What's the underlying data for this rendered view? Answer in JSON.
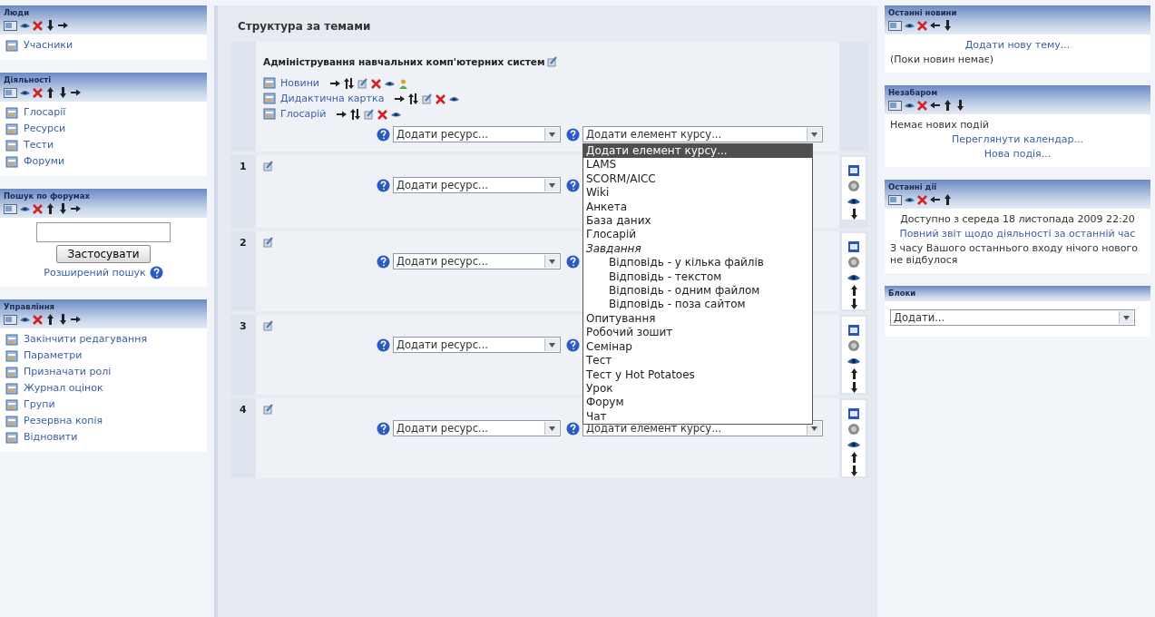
{
  "left_blocks": [
    {
      "title": "Люди",
      "controls": [
        {
          "kind": "edit"
        },
        {
          "kind": "hide"
        },
        {
          "kind": "delete"
        },
        {
          "kind": "down"
        },
        {
          "kind": "right"
        }
      ],
      "content": [
        {
          "kind": "item",
          "label": "Учасники"
        }
      ]
    },
    {
      "title": "Діяльності",
      "controls": [
        {
          "kind": "edit"
        },
        {
          "kind": "hide"
        },
        {
          "kind": "delete"
        },
        {
          "kind": "up"
        },
        {
          "kind": "down"
        },
        {
          "kind": "right"
        }
      ],
      "content": [
        {
          "kind": "item",
          "label": "Глосарії"
        },
        {
          "kind": "item",
          "label": "Ресурси"
        },
        {
          "kind": "item",
          "label": "Тести"
        },
        {
          "kind": "item",
          "label": "Форуми"
        }
      ]
    },
    {
      "title": "Пошук по форумах",
      "controls": [
        {
          "kind": "edit"
        },
        {
          "kind": "hide"
        },
        {
          "kind": "delete"
        },
        {
          "kind": "up"
        },
        {
          "kind": "down"
        },
        {
          "kind": "right"
        }
      ],
      "content": [
        {
          "kind": "search",
          "button": "Застосувати",
          "link": "Розширений пошук"
        }
      ]
    },
    {
      "title": "Управління",
      "controls": [
        {
          "kind": "edit"
        },
        {
          "kind": "hide"
        },
        {
          "kind": "delete"
        },
        {
          "kind": "up"
        },
        {
          "kind": "down"
        },
        {
          "kind": "right"
        }
      ],
      "content": [
        {
          "kind": "item",
          "label": "Закінчити редагування"
        },
        {
          "kind": "item",
          "label": "Параметри"
        },
        {
          "kind": "item",
          "label": "Призначати ролі"
        },
        {
          "kind": "item",
          "label": "Журнал оцінок"
        },
        {
          "kind": "item",
          "label": "Групи"
        },
        {
          "kind": "item",
          "label": "Резервна копія"
        },
        {
          "kind": "item",
          "label": "Відновити"
        }
      ]
    }
  ],
  "main": {
    "title": "Структура за темами",
    "sections": [
      {
        "title": "Адміністрування навчальних комп'ютерних систем",
        "activities": [
          {
            "label": "Новини",
            "controls": [
              {
                "kind": "right"
              },
              {
                "kind": "move"
              },
              {
                "kind": "editdoc"
              },
              {
                "kind": "delete"
              },
              {
                "kind": "hide"
              },
              {
                "kind": "group"
              }
            ]
          },
          {
            "label": "Дидактична картка",
            "controls": [
              {
                "kind": "right"
              },
              {
                "kind": "move"
              },
              {
                "kind": "editdoc"
              },
              {
                "kind": "delete"
              },
              {
                "kind": "hide"
              }
            ]
          },
          {
            "label": "Глосарій",
            "controls": [
              {
                "kind": "right"
              },
              {
                "kind": "move"
              },
              {
                "kind": "editdoc"
              },
              {
                "kind": "delete"
              },
              {
                "kind": "hide"
              }
            ]
          }
        ],
        "resource_select": "Додати ресурс...",
        "activity_select": "Додати елемент курсу...",
        "dropdown": [
          {
            "label": "Додати елемент курсу...",
            "selected": true
          },
          {
            "label": "LAMS",
            "selected": false
          },
          {
            "label": "SCORM/AICC",
            "selected": false
          },
          {
            "label": "Wiki",
            "selected": false
          },
          {
            "label": "Анкета",
            "selected": false
          },
          {
            "label": "База даних",
            "selected": false
          },
          {
            "label": "Глосарій",
            "selected": false
          },
          {
            "label": "Завдання",
            "selected": false,
            "children": [
              {
                "label": "Відповідь - у кілька файлів",
                "selected": false
              },
              {
                "label": "Відповідь - текстом",
                "selected": false
              },
              {
                "label": "Відповідь - одним файлом",
                "selected": false
              },
              {
                "label": "Відповідь - поза сайтом",
                "selected": false
              }
            ]
          },
          {
            "label": "Опитування",
            "selected": false
          },
          {
            "label": "Робочий зошит",
            "selected": false
          },
          {
            "label": "Семінар",
            "selected": false
          },
          {
            "label": "Тест",
            "selected": false
          },
          {
            "label": "Тест у Hot Potatoes",
            "selected": false
          },
          {
            "label": "Урок",
            "selected": false
          },
          {
            "label": "Форум",
            "selected": false
          },
          {
            "label": "Чат",
            "selected": false
          }
        ]
      },
      {
        "number": "1",
        "resource_select": "Додати ресурс...",
        "side_controls": [
          {
            "kind": "box"
          },
          {
            "kind": "circle"
          },
          {
            "kind": "hide"
          },
          {
            "kind": "down"
          }
        ]
      },
      {
        "number": "2",
        "resource_select": "Додати ресурс...",
        "side_controls": [
          {
            "kind": "box"
          },
          {
            "kind": "circle"
          },
          {
            "kind": "hide"
          },
          {
            "kind": "up"
          },
          {
            "kind": "down"
          }
        ]
      },
      {
        "number": "3",
        "resource_select": "Додати ресурс...",
        "side_controls": [
          {
            "kind": "box"
          },
          {
            "kind": "circle"
          },
          {
            "kind": "hide"
          },
          {
            "kind": "up"
          },
          {
            "kind": "down"
          }
        ]
      },
      {
        "number": "4",
        "resource_select": "Додати ресурс...",
        "activity_select": "Додати елемент курсу...",
        "side_controls": [
          {
            "kind": "box"
          },
          {
            "kind": "circle"
          },
          {
            "kind": "hide"
          },
          {
            "kind": "up"
          },
          {
            "kind": "down"
          }
        ]
      }
    ]
  },
  "right_blocks": [
    {
      "title": "Останні новини",
      "controls": [
        {
          "kind": "edit"
        },
        {
          "kind": "hide"
        },
        {
          "kind": "delete"
        },
        {
          "kind": "left"
        },
        {
          "kind": "down"
        }
      ],
      "content": [
        {
          "kind": "link",
          "text": "Додати нову тему..."
        },
        {
          "kind": "text",
          "text": "(Поки новин немає)"
        }
      ]
    },
    {
      "title": "Незабаром",
      "controls": [
        {
          "kind": "edit"
        },
        {
          "kind": "hide"
        },
        {
          "kind": "delete"
        },
        {
          "kind": "left"
        },
        {
          "kind": "up"
        },
        {
          "kind": "down"
        }
      ],
      "content": [
        {
          "kind": "text",
          "text": "Немає нових подій"
        },
        {
          "kind": "link",
          "text": "Переглянути календар..."
        },
        {
          "kind": "link",
          "text": "Нова подія..."
        }
      ]
    },
    {
      "title": "Останні дії",
      "controls": [
        {
          "kind": "edit"
        },
        {
          "kind": "hide"
        },
        {
          "kind": "delete"
        },
        {
          "kind": "left"
        },
        {
          "kind": "up"
        }
      ],
      "content": [
        {
          "kind": "center_text",
          "text": "Доступно з середа 18 листопада 2009 22:20"
        },
        {
          "kind": "link",
          "text": "Повний звіт щодо діяльності за останній час"
        },
        {
          "kind": "text",
          "text": "З часу Вашого останнього входу нічого нового не відбулося"
        }
      ]
    },
    {
      "title": "Блоки",
      "content": [
        {
          "kind": "select",
          "text": "Додати..."
        }
      ]
    }
  ]
}
